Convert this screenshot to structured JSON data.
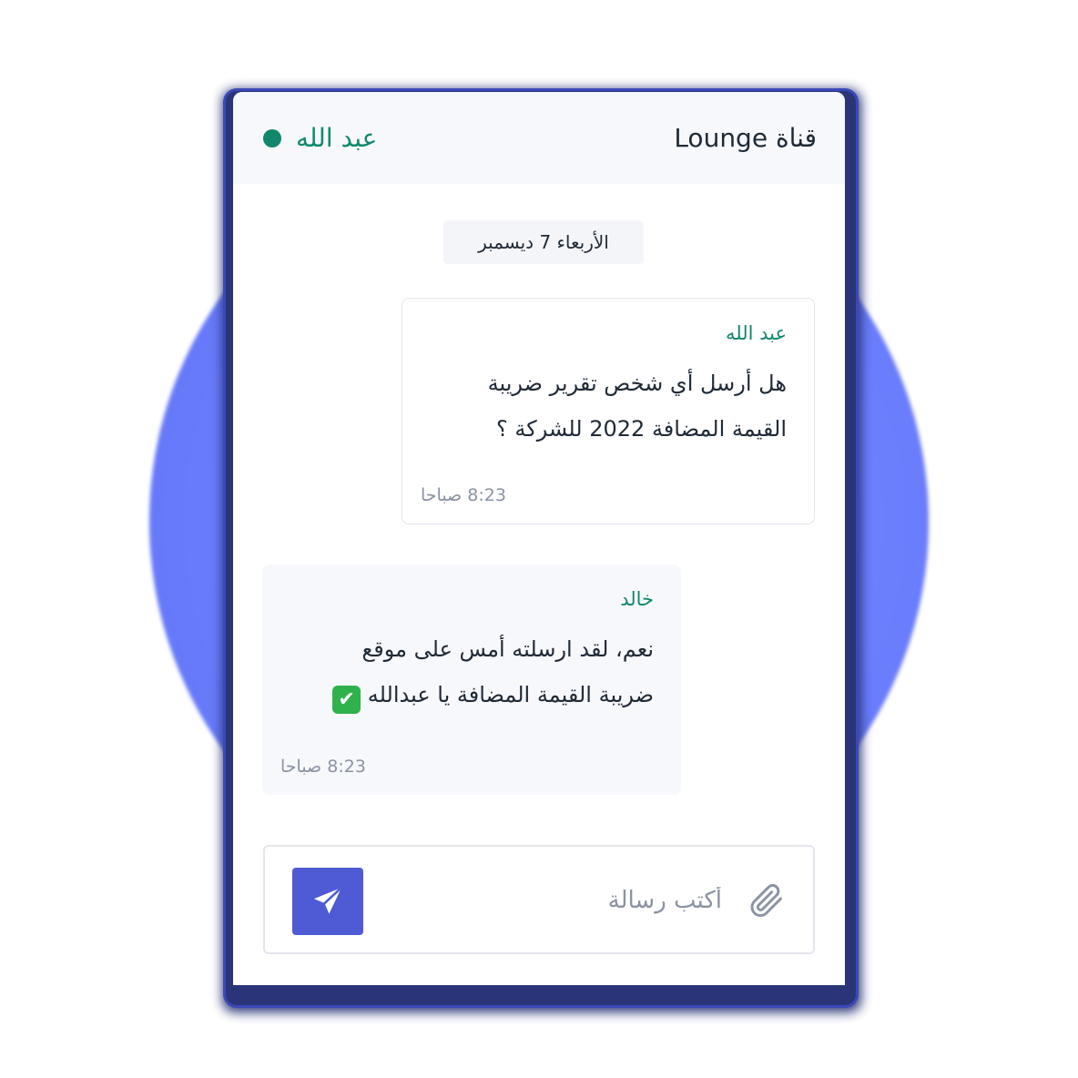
{
  "header": {
    "channel_title": "قناة Lounge",
    "user_name": "عبد الله"
  },
  "chat": {
    "date": "الأربعاء 7 ديسمبر",
    "messages": [
      {
        "author": "عبد الله",
        "lines": [
          "هل أرسل أي شخص تقرير ضريبة",
          "القيمة المضافة 2022 للشركة ؟"
        ],
        "time": "8:23 صباحا"
      },
      {
        "author": "خالد",
        "lines": [
          "نعم، لقد ارسلته أمس على موقع",
          "ضريبة القيمة المضافة يا عبدالله"
        ],
        "emoji": "✔",
        "time": "8:23 صباحا"
      }
    ]
  },
  "composer": {
    "placeholder": "أكتب رسالة",
    "attach_icon": "paperclip-icon",
    "send_icon": "paper-plane-icon"
  },
  "colors": {
    "accent": "#4f5bd5",
    "online": "#10876b",
    "author": "#13876d",
    "circle": "#6f82ff"
  }
}
